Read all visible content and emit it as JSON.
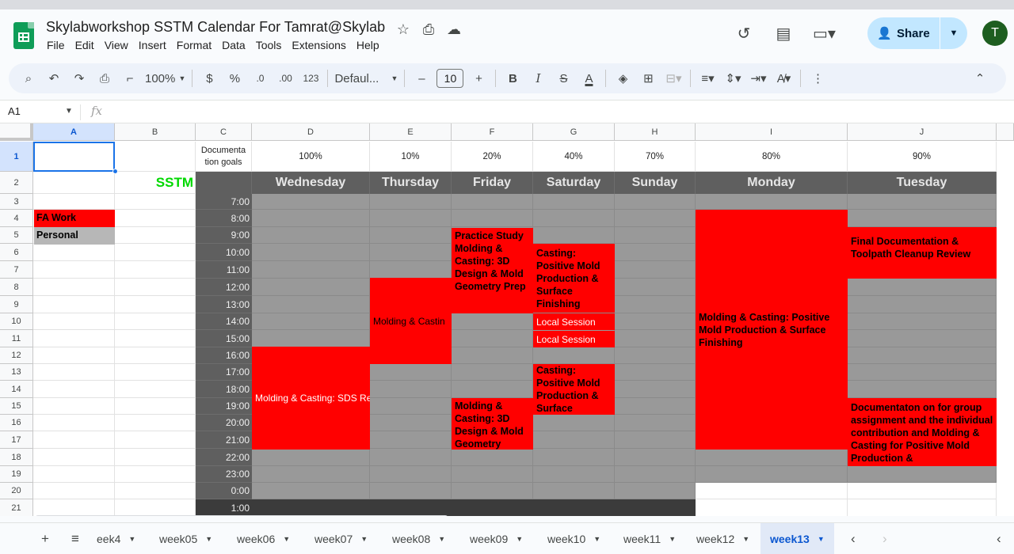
{
  "doc": {
    "title": "Skylabworkshop SSTM Calendar For Tamrat@Skylab",
    "menu": [
      "File",
      "Edit",
      "View",
      "Insert",
      "Format",
      "Data",
      "Tools",
      "Extensions",
      "Help"
    ],
    "share_label": "Share",
    "avatar_letter": "T"
  },
  "toolbar": {
    "zoom": "100%",
    "currency": "$",
    "percent": "%",
    "dec_decrease": ".0",
    "dec_increase": ".00",
    "number_format": "123",
    "font": "Defaul...",
    "font_size": "10",
    "minus": "–",
    "plus": "+",
    "bold": "B",
    "italic": "I",
    "strike": "S",
    "textcolor": "A"
  },
  "formula": {
    "cell_ref": "A1",
    "fx": "fx"
  },
  "grid": {
    "columns": [
      {
        "id": "A",
        "label": "A"
      },
      {
        "id": "B",
        "label": "B"
      },
      {
        "id": "C",
        "label": "C"
      },
      {
        "id": "D",
        "label": "D"
      },
      {
        "id": "E",
        "label": "E"
      },
      {
        "id": "F",
        "label": "F"
      },
      {
        "id": "G",
        "label": "G"
      },
      {
        "id": "H",
        "label": "H"
      },
      {
        "id": "I",
        "label": "I"
      },
      {
        "id": "J",
        "label": "J"
      }
    ],
    "rows": [
      "1",
      "2",
      "3",
      "4",
      "5",
      "6",
      "7",
      "8",
      "9",
      "10",
      "11",
      "12",
      "13",
      "14",
      "15",
      "16",
      "17",
      "18",
      "19",
      "20",
      "21"
    ],
    "row1": {
      "c": "Documenta\ntion goals",
      "d": "100%",
      "e": "10%",
      "f": "20%",
      "g": "40%",
      "h": "70%",
      "i": "80%",
      "j": "90%"
    },
    "sstm_label": "SSTM",
    "days": [
      "Wednesday",
      "Thursday",
      "Friday",
      "Saturday",
      "Sunday",
      "Monday",
      "Tuesday"
    ],
    "times": [
      "7:00",
      "8:00",
      "9:00",
      "10:00",
      "11:00",
      "12:00",
      "13:00",
      "14:00",
      "15:00",
      "16:00",
      "17:00",
      "18:00",
      "19:00",
      "20:00",
      "21:00",
      "22:00",
      "23:00",
      "0:00",
      "1:00"
    ],
    "legend": {
      "fa_work": "FA Work",
      "personal": "Personal"
    },
    "legend_colors": {
      "fa_work": "#ff0000",
      "personal": "#b7b7b7"
    },
    "events": {
      "thu_molding": "Molding & Castin",
      "fri_practice": "Practice Study Molding & Casting: 3D Design & Mold Geometry Prep",
      "sat_positive1": "Casting: Positive Mold Production & Surface Finishing",
      "sat_local1": "Local Session",
      "sat_local2": "Local Session",
      "mon_molding": "Molding & Casting: Positive Mold Production & Surface Finishing",
      "tue_final": "Final Documentation & Toolpath Cleanup Review",
      "wed_sds": "Molding & Casting: SDS Rev",
      "sat_positive2": "Casting: Positive Mold Production & Surface Finishing",
      "fri_3d": "Molding & Casting: 3D Design & Mold Geometry",
      "tue_doc": "Documentaton on for group assignment and the individual contribution and Molding & Casting for Positive Mold Production &"
    }
  },
  "sheets": {
    "tabs": [
      "eek4",
      "week05",
      "week06",
      "week07",
      "week08",
      "week09",
      "week10",
      "week11",
      "week12",
      "week13"
    ],
    "active": "week13"
  }
}
